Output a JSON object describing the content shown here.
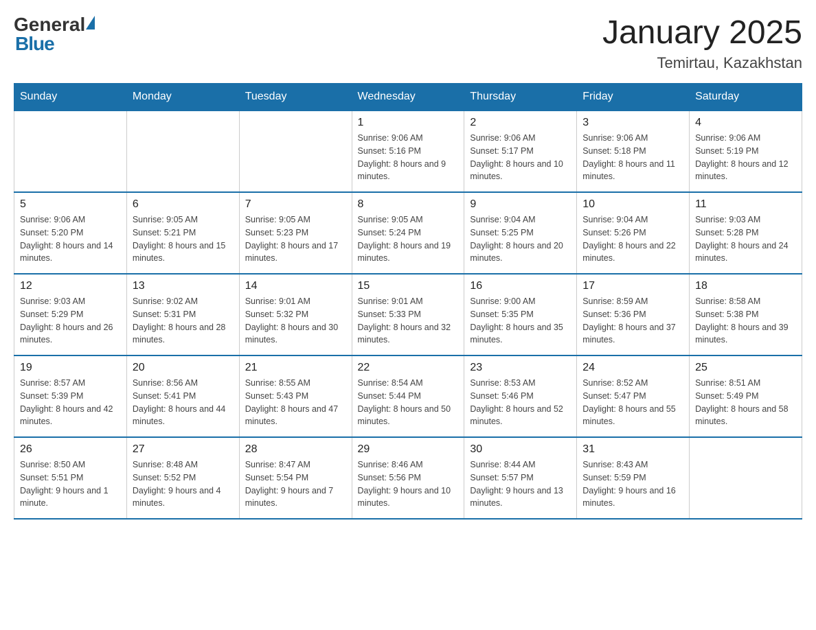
{
  "header": {
    "logo_general": "General",
    "logo_blue": "Blue",
    "month_title": "January 2025",
    "location": "Temirtau, Kazakhstan"
  },
  "columns": [
    "Sunday",
    "Monday",
    "Tuesday",
    "Wednesday",
    "Thursday",
    "Friday",
    "Saturday"
  ],
  "weeks": [
    [
      {
        "day": "",
        "sunrise": "",
        "sunset": "",
        "daylight": ""
      },
      {
        "day": "",
        "sunrise": "",
        "sunset": "",
        "daylight": ""
      },
      {
        "day": "",
        "sunrise": "",
        "sunset": "",
        "daylight": ""
      },
      {
        "day": "1",
        "sunrise": "Sunrise: 9:06 AM",
        "sunset": "Sunset: 5:16 PM",
        "daylight": "Daylight: 8 hours and 9 minutes."
      },
      {
        "day": "2",
        "sunrise": "Sunrise: 9:06 AM",
        "sunset": "Sunset: 5:17 PM",
        "daylight": "Daylight: 8 hours and 10 minutes."
      },
      {
        "day": "3",
        "sunrise": "Sunrise: 9:06 AM",
        "sunset": "Sunset: 5:18 PM",
        "daylight": "Daylight: 8 hours and 11 minutes."
      },
      {
        "day": "4",
        "sunrise": "Sunrise: 9:06 AM",
        "sunset": "Sunset: 5:19 PM",
        "daylight": "Daylight: 8 hours and 12 minutes."
      }
    ],
    [
      {
        "day": "5",
        "sunrise": "Sunrise: 9:06 AM",
        "sunset": "Sunset: 5:20 PM",
        "daylight": "Daylight: 8 hours and 14 minutes."
      },
      {
        "day": "6",
        "sunrise": "Sunrise: 9:05 AM",
        "sunset": "Sunset: 5:21 PM",
        "daylight": "Daylight: 8 hours and 15 minutes."
      },
      {
        "day": "7",
        "sunrise": "Sunrise: 9:05 AM",
        "sunset": "Sunset: 5:23 PM",
        "daylight": "Daylight: 8 hours and 17 minutes."
      },
      {
        "day": "8",
        "sunrise": "Sunrise: 9:05 AM",
        "sunset": "Sunset: 5:24 PM",
        "daylight": "Daylight: 8 hours and 19 minutes."
      },
      {
        "day": "9",
        "sunrise": "Sunrise: 9:04 AM",
        "sunset": "Sunset: 5:25 PM",
        "daylight": "Daylight: 8 hours and 20 minutes."
      },
      {
        "day": "10",
        "sunrise": "Sunrise: 9:04 AM",
        "sunset": "Sunset: 5:26 PM",
        "daylight": "Daylight: 8 hours and 22 minutes."
      },
      {
        "day": "11",
        "sunrise": "Sunrise: 9:03 AM",
        "sunset": "Sunset: 5:28 PM",
        "daylight": "Daylight: 8 hours and 24 minutes."
      }
    ],
    [
      {
        "day": "12",
        "sunrise": "Sunrise: 9:03 AM",
        "sunset": "Sunset: 5:29 PM",
        "daylight": "Daylight: 8 hours and 26 minutes."
      },
      {
        "day": "13",
        "sunrise": "Sunrise: 9:02 AM",
        "sunset": "Sunset: 5:31 PM",
        "daylight": "Daylight: 8 hours and 28 minutes."
      },
      {
        "day": "14",
        "sunrise": "Sunrise: 9:01 AM",
        "sunset": "Sunset: 5:32 PM",
        "daylight": "Daylight: 8 hours and 30 minutes."
      },
      {
        "day": "15",
        "sunrise": "Sunrise: 9:01 AM",
        "sunset": "Sunset: 5:33 PM",
        "daylight": "Daylight: 8 hours and 32 minutes."
      },
      {
        "day": "16",
        "sunrise": "Sunrise: 9:00 AM",
        "sunset": "Sunset: 5:35 PM",
        "daylight": "Daylight: 8 hours and 35 minutes."
      },
      {
        "day": "17",
        "sunrise": "Sunrise: 8:59 AM",
        "sunset": "Sunset: 5:36 PM",
        "daylight": "Daylight: 8 hours and 37 minutes."
      },
      {
        "day": "18",
        "sunrise": "Sunrise: 8:58 AM",
        "sunset": "Sunset: 5:38 PM",
        "daylight": "Daylight: 8 hours and 39 minutes."
      }
    ],
    [
      {
        "day": "19",
        "sunrise": "Sunrise: 8:57 AM",
        "sunset": "Sunset: 5:39 PM",
        "daylight": "Daylight: 8 hours and 42 minutes."
      },
      {
        "day": "20",
        "sunrise": "Sunrise: 8:56 AM",
        "sunset": "Sunset: 5:41 PM",
        "daylight": "Daylight: 8 hours and 44 minutes."
      },
      {
        "day": "21",
        "sunrise": "Sunrise: 8:55 AM",
        "sunset": "Sunset: 5:43 PM",
        "daylight": "Daylight: 8 hours and 47 minutes."
      },
      {
        "day": "22",
        "sunrise": "Sunrise: 8:54 AM",
        "sunset": "Sunset: 5:44 PM",
        "daylight": "Daylight: 8 hours and 50 minutes."
      },
      {
        "day": "23",
        "sunrise": "Sunrise: 8:53 AM",
        "sunset": "Sunset: 5:46 PM",
        "daylight": "Daylight: 8 hours and 52 minutes."
      },
      {
        "day": "24",
        "sunrise": "Sunrise: 8:52 AM",
        "sunset": "Sunset: 5:47 PM",
        "daylight": "Daylight: 8 hours and 55 minutes."
      },
      {
        "day": "25",
        "sunrise": "Sunrise: 8:51 AM",
        "sunset": "Sunset: 5:49 PM",
        "daylight": "Daylight: 8 hours and 58 minutes."
      }
    ],
    [
      {
        "day": "26",
        "sunrise": "Sunrise: 8:50 AM",
        "sunset": "Sunset: 5:51 PM",
        "daylight": "Daylight: 9 hours and 1 minute."
      },
      {
        "day": "27",
        "sunrise": "Sunrise: 8:48 AM",
        "sunset": "Sunset: 5:52 PM",
        "daylight": "Daylight: 9 hours and 4 minutes."
      },
      {
        "day": "28",
        "sunrise": "Sunrise: 8:47 AM",
        "sunset": "Sunset: 5:54 PM",
        "daylight": "Daylight: 9 hours and 7 minutes."
      },
      {
        "day": "29",
        "sunrise": "Sunrise: 8:46 AM",
        "sunset": "Sunset: 5:56 PM",
        "daylight": "Daylight: 9 hours and 10 minutes."
      },
      {
        "day": "30",
        "sunrise": "Sunrise: 8:44 AM",
        "sunset": "Sunset: 5:57 PM",
        "daylight": "Daylight: 9 hours and 13 minutes."
      },
      {
        "day": "31",
        "sunrise": "Sunrise: 8:43 AM",
        "sunset": "Sunset: 5:59 PM",
        "daylight": "Daylight: 9 hours and 16 minutes."
      },
      {
        "day": "",
        "sunrise": "",
        "sunset": "",
        "daylight": ""
      }
    ]
  ]
}
